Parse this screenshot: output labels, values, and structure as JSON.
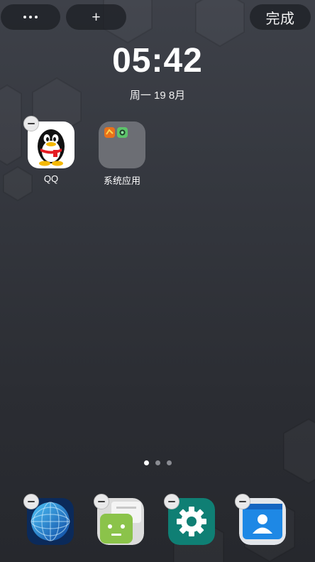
{
  "top_bar": {
    "more_button": {
      "icon": "more-dots-icon"
    },
    "add_button": {
      "label": "+"
    },
    "done_button": {
      "label": "完成"
    }
  },
  "clock": {
    "time": "05:42",
    "date": "周一 19 8月"
  },
  "home_apps": [
    {
      "label": "QQ",
      "icon": "qq-penguin-icon",
      "removable": true
    },
    {
      "label": "系统应用",
      "icon": "folder-icon",
      "removable": false
    }
  ],
  "page_indicator": {
    "count": 3,
    "active": 1
  },
  "dock_apps": [
    {
      "name": "browser",
      "icon": "globe-icon",
      "removable": true
    },
    {
      "name": "file-manager",
      "icon": "android-robot-icon",
      "removable": true
    },
    {
      "name": "settings",
      "icon": "gear-icon",
      "removable": true
    },
    {
      "name": "contacts",
      "icon": "contacts-icon",
      "removable": true
    }
  ],
  "colors": {
    "background": "#34373e",
    "pill": "#1e2025",
    "settings_teal": "#0f7f74",
    "android_green": "#8bc34a",
    "contacts_blue": "#1e88e5"
  }
}
